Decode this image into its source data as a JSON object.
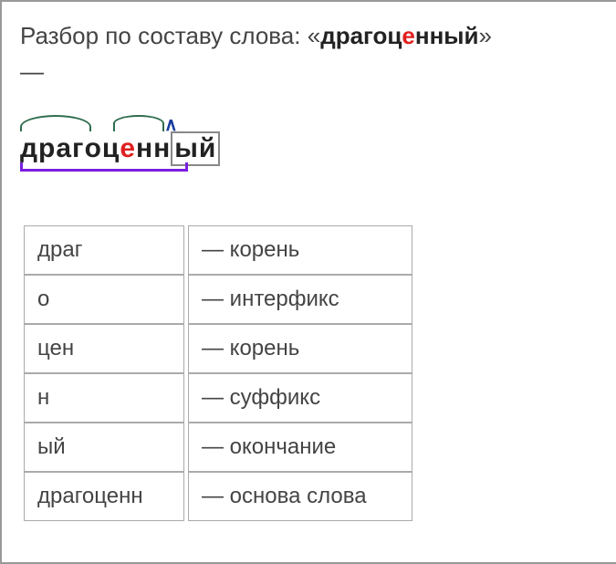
{
  "title": {
    "prefix": "Разбор по составу слова: «",
    "word_p1": "драгоц",
    "word_red": "е",
    "word_p2": "нный",
    "suffix": "»",
    "dash": "—"
  },
  "morph": {
    "root1": "драг",
    "interfix": "о",
    "root2_p1": "ц",
    "root2_red": "е",
    "root2_p2": "н",
    "suffix": "н",
    "ending": "ый"
  },
  "table": {
    "rows": [
      {
        "part": "драг",
        "desc": "— корень"
      },
      {
        "part": "о",
        "desc": "— интерфикс"
      },
      {
        "part": "цен",
        "desc": "— корень"
      },
      {
        "part": "н",
        "desc": "— суффикс"
      },
      {
        "part": "ый",
        "desc": "— окончание"
      },
      {
        "part": "драгоценн",
        "desc": "— основа слова"
      }
    ]
  }
}
